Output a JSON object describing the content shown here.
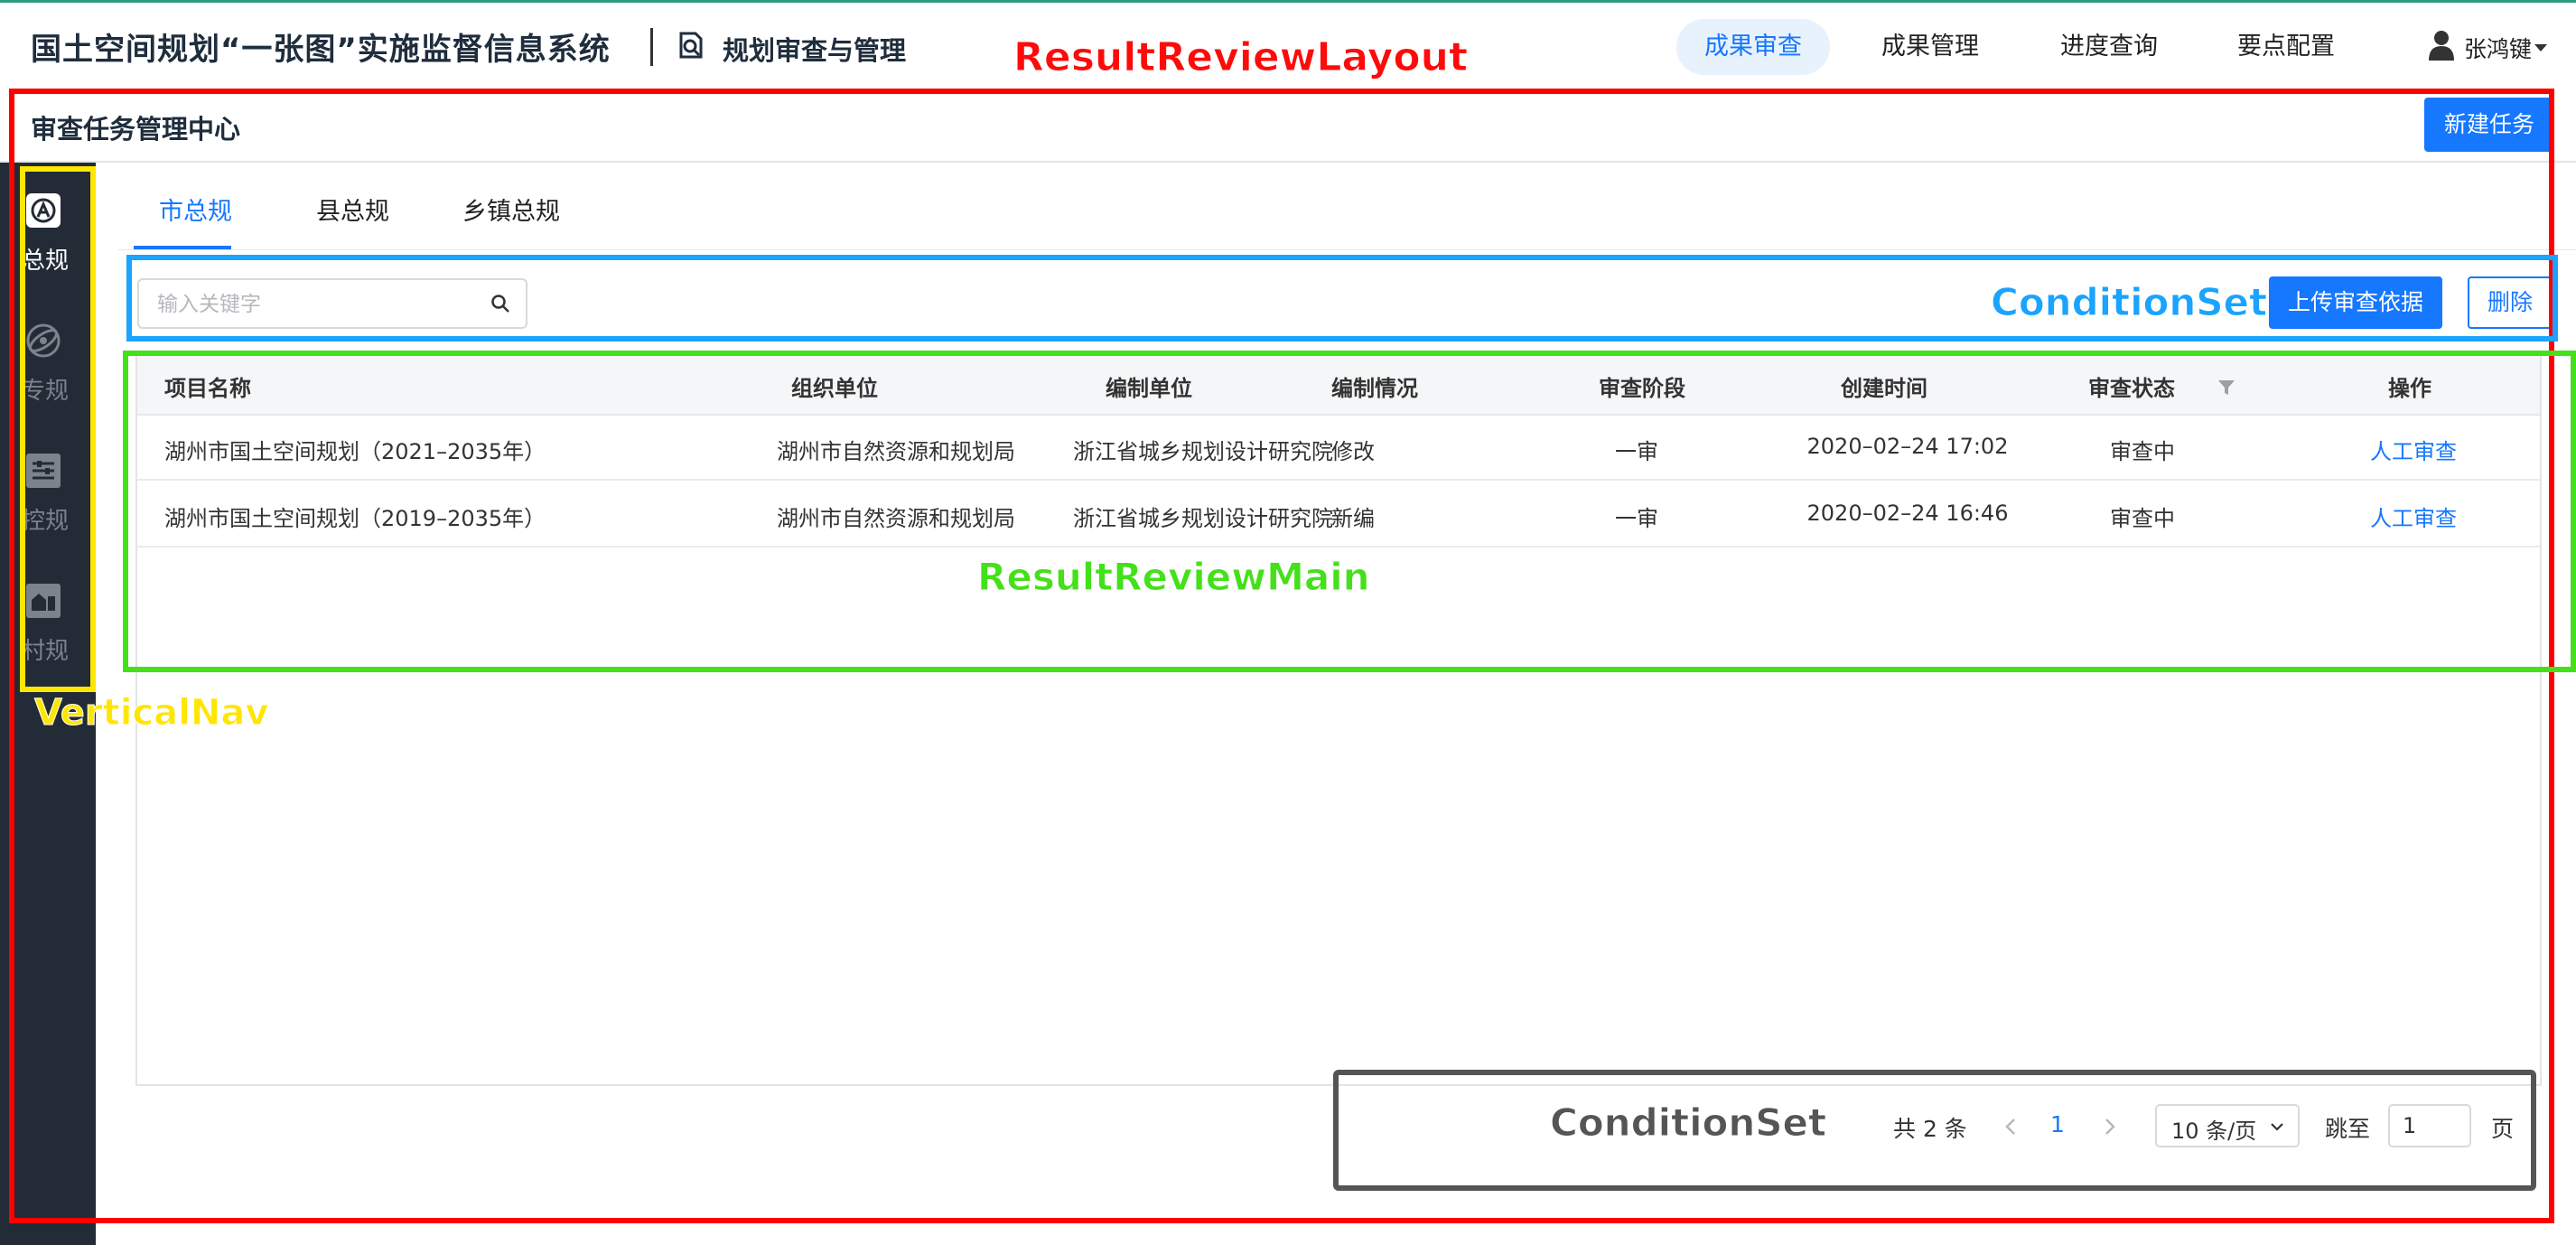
{
  "header": {
    "app_title": "国土空间规划“一张图”实施监督信息系统",
    "module_name": "规划审查与管理",
    "nav": [
      "成果审查",
      "成果管理",
      "进度查询",
      "要点配置"
    ],
    "active_nav": "成果审查",
    "user_name": "张鸿键"
  },
  "page": {
    "title": "审查任务管理中心",
    "new_task_label": "新建任务"
  },
  "vertical_nav": {
    "items": [
      {
        "label": "总规",
        "icon": "master-plan-icon",
        "active": true
      },
      {
        "label": "专规",
        "icon": "special-plan-icon",
        "active": false
      },
      {
        "label": "控规",
        "icon": "control-plan-icon",
        "active": false
      },
      {
        "label": "村规",
        "icon": "village-plan-icon",
        "active": false
      }
    ]
  },
  "tabs": [
    "市总规",
    "县总规",
    "乡镇总规"
  ],
  "active_tab": "市总规",
  "search": {
    "placeholder": "输入关键字",
    "value": ""
  },
  "actions": {
    "upload_label": "上传审查依据",
    "delete_label": "删除"
  },
  "table": {
    "columns": [
      "项目名称",
      "组织单位",
      "编制单位",
      "编制情况",
      "审查阶段",
      "创建时间",
      "审查状态",
      "操作"
    ],
    "rows": [
      [
        "湖州市国土空间规划（2021–2035年）",
        "湖州市自然资源和规划局",
        "浙江省城乡规划设计研究院",
        "修改",
        "一审",
        "2020–02–24 17:02",
        "审查中",
        "人工审查"
      ],
      [
        "湖州市国土空间规划（2019–2035年）",
        "湖州市自然资源和规划局",
        "浙江省城乡规划设计研究院",
        "新编",
        "一审",
        "2020–02–24 16:46",
        "审查中",
        "人工审查"
      ]
    ]
  },
  "pagination": {
    "total_label": "共 2 条",
    "current_page": "1",
    "page_size_label": "10 条/页",
    "jump_label": "跳至",
    "jump_value": "1",
    "page_suffix": "页"
  },
  "annotations": {
    "result_review_layout": "ResultReviewLayout",
    "condition_set_top": "ConditionSet",
    "result_review_main": "ResultReviewMain",
    "vertical_nav": "VerticalNav",
    "condition_set_bottom": "ConditionSet"
  },
  "colors": {
    "primary": "#1677ff",
    "nav_bg": "#222b36",
    "layout_annotation": "#ff0000",
    "condition_annotation": "#1aa3ff",
    "main_annotation": "#44e01a",
    "nav_annotation": "#ffe600",
    "pagination_annotation": "#555555"
  }
}
